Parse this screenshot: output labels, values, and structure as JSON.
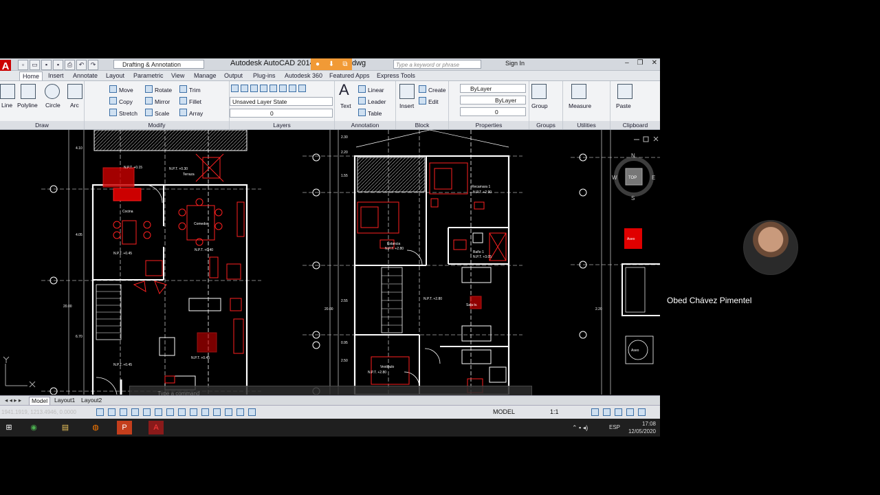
{
  "app": {
    "logo": "A",
    "title": "Autodesk AutoCAD 2014",
    "file_suffix": "dwg",
    "workspace": "Drafting & Annotation",
    "search_placeholder": "Type a keyword or phrase",
    "sign_in": "Sign In"
  },
  "ribbon_tabs": [
    "Home",
    "Insert",
    "Annotate",
    "Layout",
    "Parametric",
    "View",
    "Manage",
    "Output",
    "Plug-ins",
    "Autodesk 360",
    "Featured Apps",
    "Express Tools"
  ],
  "ribbon": {
    "draw": {
      "title": "Draw",
      "line": "Line",
      "polyline": "Polyline",
      "circle": "Circle",
      "arc": "Arc"
    },
    "modify": {
      "title": "Modify",
      "move": "Move",
      "rotate": "Rotate",
      "trim": "Trim",
      "copy": "Copy",
      "mirror": "Mirror",
      "fillet": "Fillet",
      "stretch": "Stretch",
      "scale": "Scale",
      "array": "Array"
    },
    "layers": {
      "title": "Layers",
      "layer_state": "Unsaved Layer State",
      "current_layer": "0"
    },
    "annotation": {
      "title": "Annotation",
      "text": "Text",
      "linear": "Linear",
      "leader": "Leader",
      "table": "Table"
    },
    "block": {
      "title": "Block",
      "insert": "Insert",
      "create": "Create",
      "edit": "Edit"
    },
    "properties": {
      "title": "Properties",
      "color": "ByLayer",
      "linetype": "ByLayer",
      "lineweight": "0"
    },
    "groups": {
      "title": "Groups",
      "group": "Group"
    },
    "utilities": {
      "title": "Utilities",
      "measure": "Measure"
    },
    "clipboard": {
      "title": "Clipboard",
      "paste": "Paste"
    }
  },
  "drawing": {
    "labels": {
      "npt_015": "N.P.T. +0.15",
      "npt_030": "N.P.T. +0.30",
      "npt_045": "N.P.T. +0.45",
      "npt_040": "N.P.T. +0.40",
      "npt_290": "N.P.T. +2.90",
      "npt_280": "N.P.T. +2.80",
      "npt_305": "N.P.T. +3.05",
      "terraza": "Terraza",
      "cocina": "Cocina",
      "comedor": "Comedor",
      "recamara": "Recamara 1",
      "estancia": "Estancia",
      "bano": "Baño 1",
      "vestibulo": "Vestibulo",
      "sala": "Sala tv.",
      "aseo": "Aseo",
      "dims": [
        "4.10",
        "4.05",
        "6.70",
        "20.00",
        "2.30",
        "2.20",
        "1.55",
        "3.65",
        "2.55",
        "0.95",
        "2.50",
        "20.00",
        "2.20"
      ]
    },
    "viewcube": {
      "n": "N",
      "s": "S",
      "e": "E",
      "w": "W",
      "top": "TOP"
    }
  },
  "command_line": "Type a command",
  "layout_tabs": [
    "Model",
    "Layout1",
    "Layout2"
  ],
  "status": {
    "coords": "1941.1919, 1213.4946, 0.0000",
    "model": "MODEL",
    "scale": "1:1"
  },
  "taskbar": {
    "lang": "ESP",
    "time": "17:08",
    "date": "12/05/2020"
  },
  "participant": {
    "name": "Obed Chávez Pimentel"
  },
  "colors": {
    "ribbon_bg": "#f2f3f5",
    "canvas_bg": "#000000",
    "accent_red": "#ff2020",
    "line_white": "#ffffff"
  }
}
